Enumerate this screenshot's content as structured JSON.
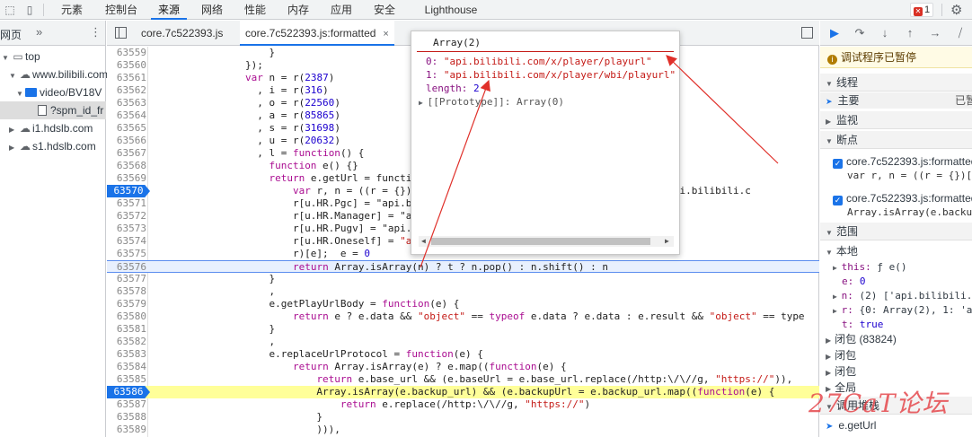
{
  "toolbar": {
    "tabs": [
      "元素",
      "控制台",
      "来源",
      "网络",
      "性能",
      "内存",
      "应用",
      "安全",
      "Lighthouse"
    ],
    "active_tab": "来源",
    "error_count": "1"
  },
  "navigator": {
    "header": "网页",
    "tree": [
      {
        "label": "top"
      },
      {
        "label": "www.bilibili.com"
      },
      {
        "label": "video/BV18V"
      },
      {
        "label": "?spm_id_fr"
      },
      {
        "label": "i1.hdslb.com"
      },
      {
        "label": "s1.hdslb.com"
      }
    ]
  },
  "editor": {
    "tabs": [
      {
        "label": "core.7c522393.js"
      },
      {
        "label": "core.7c522393.js:formatted",
        "close": "×"
      }
    ],
    "lines": [
      {
        "n": "63559",
        "t": "                    }"
      },
      {
        "n": "63560",
        "t": "                });"
      },
      {
        "n": "63561",
        "t": "                var n = r(2387)"
      },
      {
        "n": "63562",
        "t": "                  , i = r(316)"
      },
      {
        "n": "63563",
        "t": "                  , o = r(22560)"
      },
      {
        "n": "63564",
        "t": "                  , a = r(85865)"
      },
      {
        "n": "63565",
        "t": "                  , s = r(31698)"
      },
      {
        "n": "63566",
        "t": "                  , u = r(20632)"
      },
      {
        "n": "63567",
        "t": "                  , l = function() {"
      },
      {
        "n": "63568",
        "t": "                    function e() {}"
      },
      {
        "n": "63569",
        "t": "                    return e.getUrl = functi"
      },
      {
        "n": "63570",
        "t": "                        var r, n = ((r = {})                                    url\", \"api.bilibili.c"
      },
      {
        "n": "63571",
        "t": "                        r[u.HR.Pgc] = \"api.b"
      },
      {
        "n": "63572",
        "t": "                        r[u.HR.Manager] = \"a"
      },
      {
        "n": "63573",
        "t": "                        r[u.HR.Pugv] = \"api."
      },
      {
        "n": "63574",
        "t": "                        r[u.HR.Oneself] = \"a                                    l\","
      },
      {
        "n": "63575",
        "t": "                        r)[e];  e = 0"
      },
      {
        "n": "63576",
        "t": "                        return Array.isArray(n) ? t ? n.pop() : n.shift() : n"
      },
      {
        "n": "63577",
        "t": "                    }"
      },
      {
        "n": "63578",
        "t": "                    ,"
      },
      {
        "n": "63579",
        "t": "                    e.getPlayUrlBody = function(e) {"
      },
      {
        "n": "63580",
        "t": "                        return e ? e.data && \"object\" == typeof e.data ? e.data : e.result && \"object\" == type"
      },
      {
        "n": "63581",
        "t": "                    }"
      },
      {
        "n": "63582",
        "t": "                    ,"
      },
      {
        "n": "63583",
        "t": "                    e.replaceUrlProtocol = function(e) {"
      },
      {
        "n": "63584",
        "t": "                        return Array.isArray(e) ? e.map((function(e) {"
      },
      {
        "n": "63585",
        "t": "                            return e.base_url && (e.baseUrl = e.base_url.replace(/http:\\/\\//g, \"https://\")),"
      },
      {
        "n": "63586",
        "t": "                            Array.isArray(e.backup_url) && (e.backupUrl = e.backup_url.map((function(e) {"
      },
      {
        "n": "63587",
        "t": "                                return e.replace(/http:\\/\\//g, \"https://\")"
      },
      {
        "n": "63588",
        "t": "                            }"
      },
      {
        "n": "63589",
        "t": "                            ))),"
      }
    ]
  },
  "popover": {
    "title": "Array(2)",
    "items": [
      {
        "k": "0:",
        "v": "\"api.bilibili.com/x/player/playurl\""
      },
      {
        "k": "1:",
        "v": "\"api.bilibili.com/x/player/wbi/playurl\""
      }
    ],
    "length_key": "length:",
    "length_val": "2",
    "proto": "[[Prototype]]: Array(0)"
  },
  "debugger": {
    "paused": "调试程序已暂停",
    "threads": "线程",
    "main_thread": "主要",
    "main_thread_state": "已暂",
    "watch": "监视",
    "breakpoints": "断点",
    "bp_items": [
      {
        "file": "core.7c522393.js:formatted",
        "code": "var r, n = ((r = {})["
      },
      {
        "file": "core.7c522393.js:formatted",
        "code": "Array.isArray(e.backu"
      }
    ],
    "scope": "范围",
    "local": "本地",
    "scope_rows": [
      {
        "k": "this:",
        "v": "ƒ e()"
      },
      {
        "k": "e:",
        "v": "0"
      },
      {
        "k": "n:",
        "v": "(2) ['api.bilibili."
      },
      {
        "k": "r:",
        "v": "{0: Array(2), 1: 'a"
      },
      {
        "k": "t:",
        "v": "true"
      }
    ],
    "closures": [
      "闭包 (83824)",
      "闭包",
      "闭包"
    ],
    "global": "全局",
    "callstack": "调用堆栈",
    "callstack_item": "e.getUrl"
  },
  "watermark": "27CaT论坛"
}
